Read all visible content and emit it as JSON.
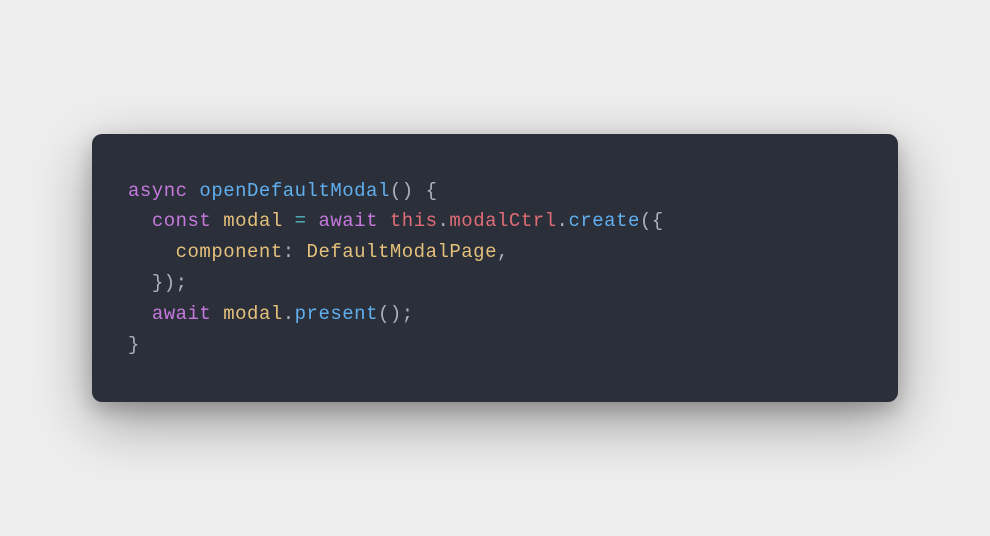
{
  "code": {
    "tokens": [
      {
        "kind": "keyword",
        "text": "async"
      },
      {
        "kind": "space",
        "text": " "
      },
      {
        "kind": "func",
        "text": "openDefaultModal"
      },
      {
        "kind": "punct",
        "text": "() {"
      },
      {
        "kind": "newline",
        "text": "\n"
      },
      {
        "kind": "indent",
        "text": "  "
      },
      {
        "kind": "keyword",
        "text": "const"
      },
      {
        "kind": "space",
        "text": " "
      },
      {
        "kind": "var",
        "text": "modal"
      },
      {
        "kind": "space",
        "text": " "
      },
      {
        "kind": "op",
        "text": "="
      },
      {
        "kind": "space",
        "text": " "
      },
      {
        "kind": "keyword",
        "text": "await"
      },
      {
        "kind": "space",
        "text": " "
      },
      {
        "kind": "this",
        "text": "this"
      },
      {
        "kind": "punct",
        "text": "."
      },
      {
        "kind": "this",
        "text": "modalCtrl"
      },
      {
        "kind": "punct",
        "text": "."
      },
      {
        "kind": "func",
        "text": "create"
      },
      {
        "kind": "punct",
        "text": "({"
      },
      {
        "kind": "newline",
        "text": "\n"
      },
      {
        "kind": "indent",
        "text": "    "
      },
      {
        "kind": "var",
        "text": "component"
      },
      {
        "kind": "punct",
        "text": ": "
      },
      {
        "kind": "type",
        "text": "DefaultModalPage"
      },
      {
        "kind": "punct",
        "text": ","
      },
      {
        "kind": "newline",
        "text": "\n"
      },
      {
        "kind": "indent",
        "text": "  "
      },
      {
        "kind": "punct",
        "text": "});"
      },
      {
        "kind": "newline",
        "text": "\n"
      },
      {
        "kind": "indent",
        "text": "  "
      },
      {
        "kind": "keyword",
        "text": "await"
      },
      {
        "kind": "space",
        "text": " "
      },
      {
        "kind": "var",
        "text": "modal"
      },
      {
        "kind": "punct",
        "text": "."
      },
      {
        "kind": "func",
        "text": "present"
      },
      {
        "kind": "punct",
        "text": "();"
      },
      {
        "kind": "newline",
        "text": "\n"
      },
      {
        "kind": "punct",
        "text": "}"
      }
    ]
  },
  "colors": {
    "background": "#eeeeee",
    "card": "#2a2f3a",
    "keyword": "#c678dd",
    "func": "#61afef",
    "punct": "#abb2bf",
    "var": "#e5c07b",
    "this": "#e06c75",
    "type": "#e5c07b",
    "op": "#56b6c2"
  }
}
